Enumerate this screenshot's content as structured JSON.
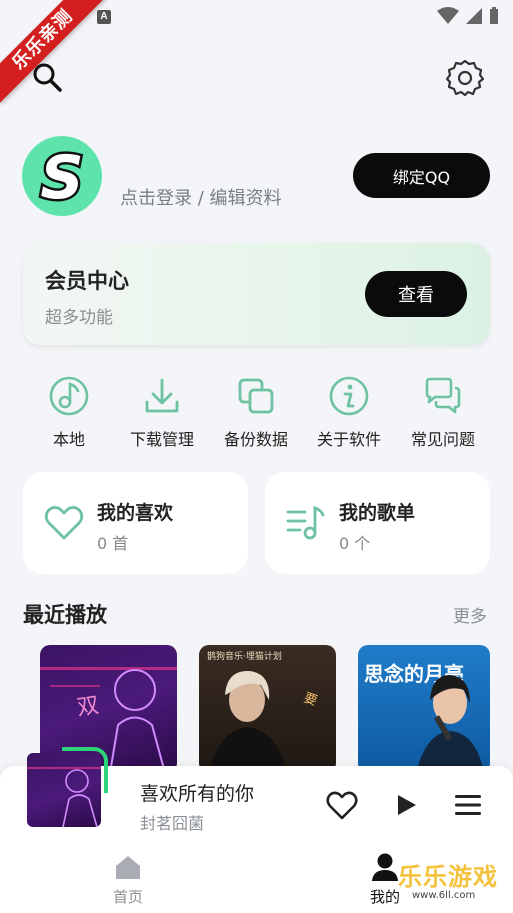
{
  "ribbon": {
    "text": "乐乐亲测"
  },
  "topbar": {
    "search_icon": "search-icon",
    "settings_icon": "gear-icon"
  },
  "profile": {
    "avatar_letter": "S",
    "login_text": "点击登录 / 编辑资料",
    "bind_label": "绑定QQ"
  },
  "vip": {
    "title": "会员中心",
    "subtitle": "超多功能",
    "button": "查看"
  },
  "quick_actions": [
    {
      "label": "本地",
      "icon": "music-note-icon"
    },
    {
      "label": "下载管理",
      "icon": "download-icon"
    },
    {
      "label": "备份数据",
      "icon": "copy-icon"
    },
    {
      "label": "关于软件",
      "icon": "info-icon"
    },
    {
      "label": "常见问题",
      "icon": "chat-icon"
    }
  ],
  "cards": [
    {
      "title": "我的喜欢",
      "count": "0 首",
      "icon": "heart-icon"
    },
    {
      "title": "我的歌单",
      "count": "0 个",
      "icon": "playlist-icon"
    }
  ],
  "recent": {
    "title": "最近播放",
    "more": "更多",
    "covers": [
      {
        "text": "双"
      },
      {
        "text": "鹊狗音乐·埋猫计划"
      },
      {
        "text": "思念的月亮"
      }
    ]
  },
  "player": {
    "title": "喜欢所有的你",
    "artist": "封茗囧菌"
  },
  "nav": {
    "home": "首页",
    "mine": "我的"
  },
  "watermark": {
    "text": "乐乐游戏",
    "url": "www.6ll.com"
  },
  "colors": {
    "accent": "#6dc3a1",
    "progress": "#2ed47a",
    "button": "#0b0b0b"
  }
}
